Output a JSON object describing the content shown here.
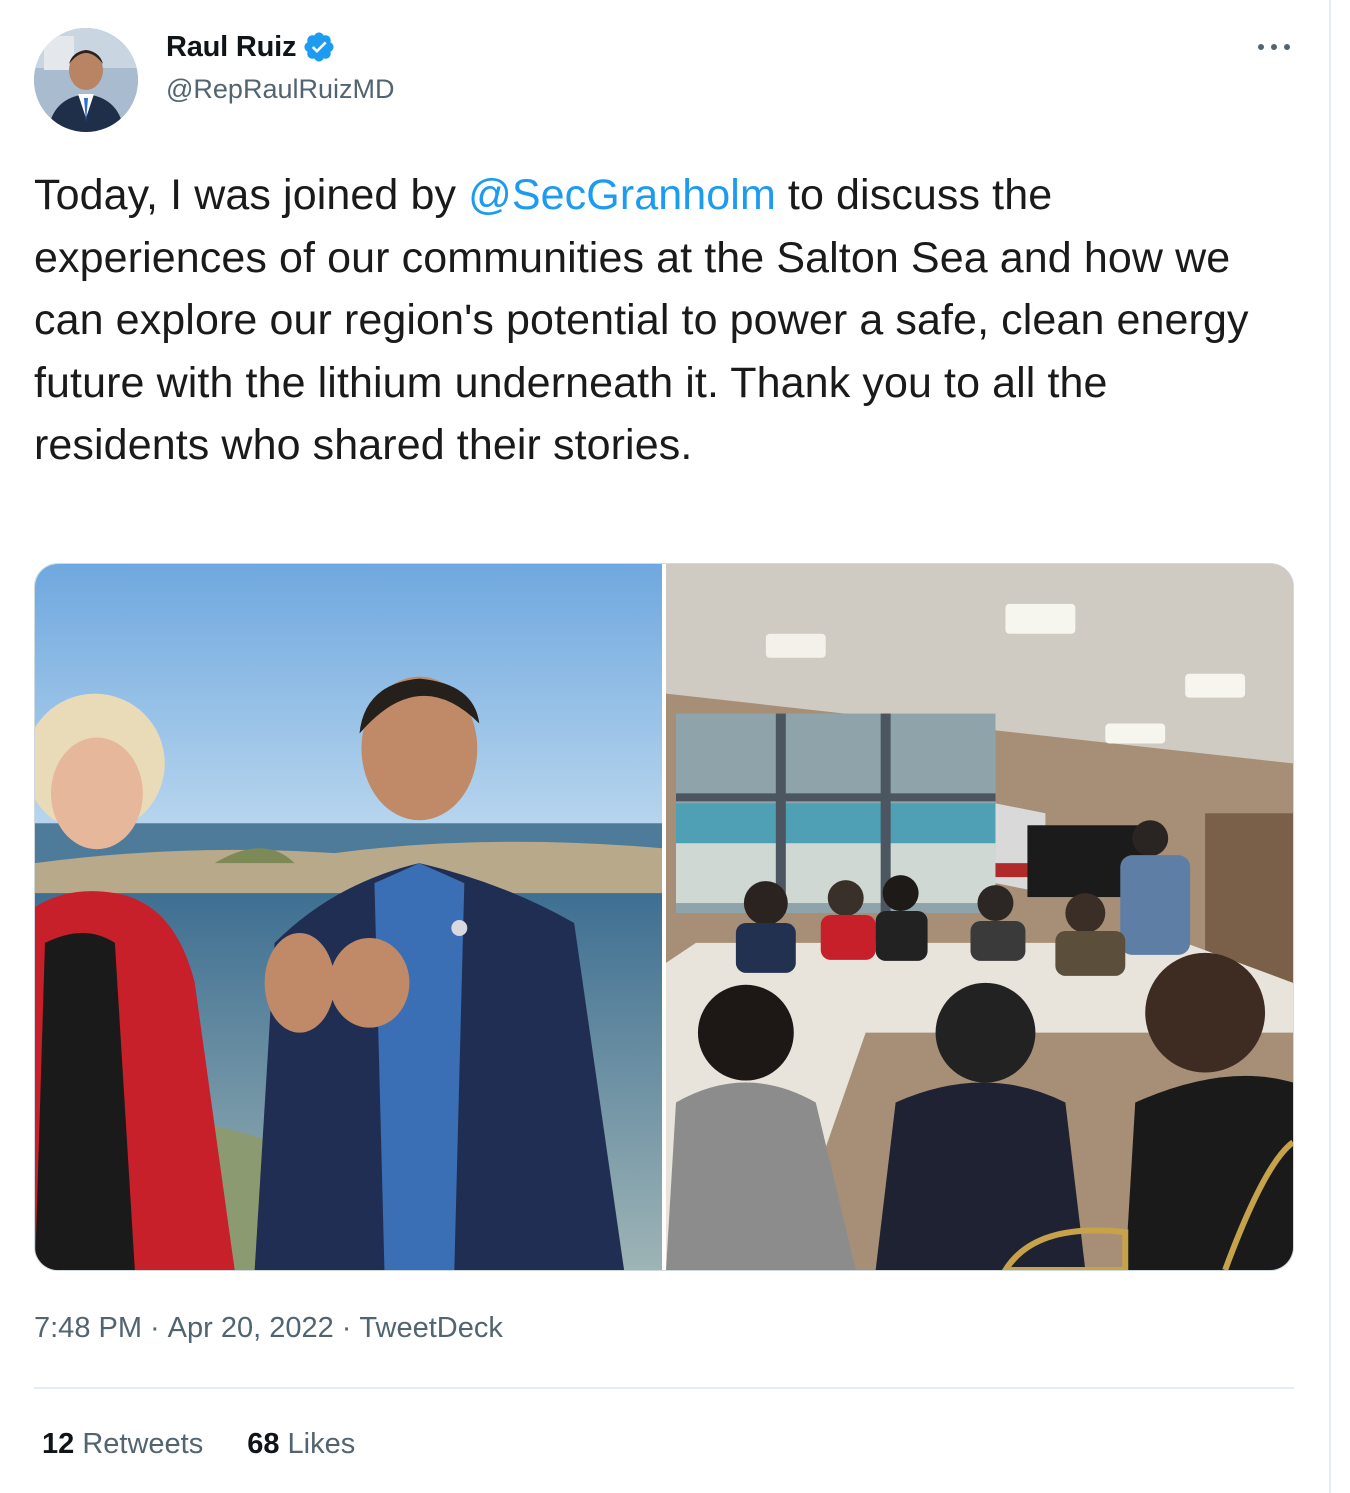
{
  "author": {
    "name": "Raul Ruiz",
    "handle": "@RepRaulRuizMD",
    "verified": true
  },
  "tweet": {
    "text_before": "Today, I was joined by ",
    "mention": "@SecGranholm",
    "text_after": " to discuss the experiences of our communities at the Salton Sea and how we can explore our region's potential to power a safe, clean energy future with the lithium underneath it. Thank you to all the residents who shared their stories."
  },
  "media": [
    {
      "icon": "photo-outdoor-sea"
    },
    {
      "icon": "photo-meeting-room"
    }
  ],
  "meta": {
    "time": "7:48 PM",
    "separator": "·",
    "date": "Apr 20, 2022",
    "source": "TweetDeck"
  },
  "stats": {
    "retweets_count": "12",
    "retweets_label": "Retweets",
    "likes_count": "68",
    "likes_label": "Likes"
  },
  "colors": {
    "accent": "#1d9bf0",
    "secondary_text": "#536471",
    "primary_text": "#0f1419"
  }
}
